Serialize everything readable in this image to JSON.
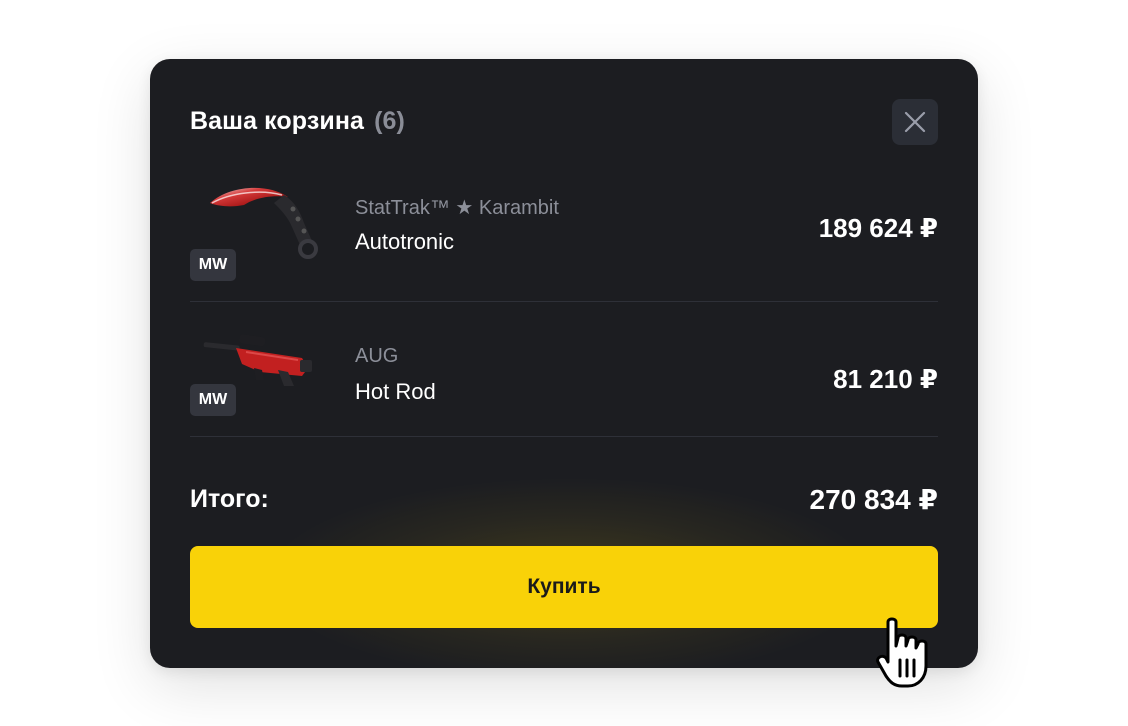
{
  "cart": {
    "title": "Ваша корзина",
    "count": "(6)",
    "items": [
      {
        "subtitle": "StatTrak™ ★ Karambit",
        "name": "Autotronic",
        "wear": "MW",
        "price": "189 624 ₽",
        "image_icon": "karambit-knife-icon"
      },
      {
        "subtitle": "AUG",
        "name": "Hot Rod",
        "wear": "MW",
        "price": "81 210 ₽",
        "image_icon": "aug-rifle-icon"
      }
    ],
    "total_label": "Итого:",
    "total_value": "270 834 ₽",
    "buy_label": "Купить"
  },
  "colors": {
    "modal_bg": "#1c1d21",
    "accent": "#f9d208",
    "muted_text": "#8c8f99",
    "badge_bg": "#34363e",
    "close_bg": "#2b2e36"
  }
}
